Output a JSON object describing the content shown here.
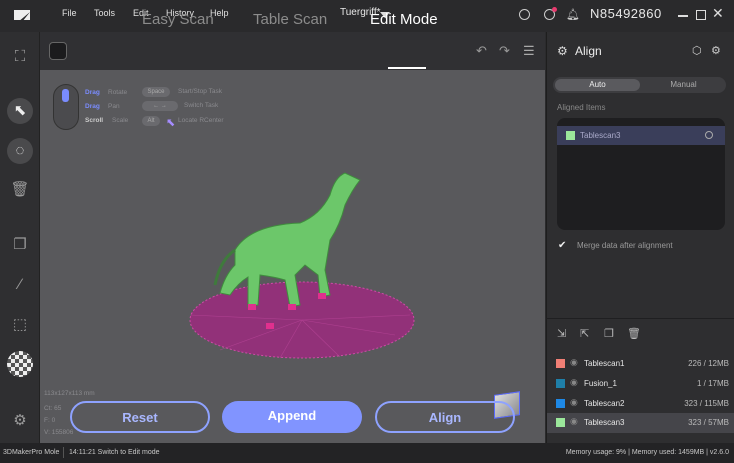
{
  "window": {
    "menu": [
      "File",
      "Tools",
      "Edit",
      "History",
      "Help"
    ],
    "document_title": "Tuergriff*",
    "user_id": "N85492860"
  },
  "scan_tabs": {
    "easy": "Easy Scan",
    "table": "Table Scan",
    "edit": "Edit Mode"
  },
  "hints": [
    {
      "key": "Drag",
      "action": "Rotate"
    },
    {
      "key": "Drag",
      "action": "Pan"
    },
    {
      "key": "Scroll",
      "action": "Scale"
    }
  ],
  "shortcuts": [
    {
      "key": "Space",
      "action": "Start/Stop Task"
    },
    {
      "key": "← →",
      "action": "Switch Task"
    },
    {
      "key": "Alt",
      "action": "Locate RCenter"
    }
  ],
  "viewport_stats": {
    "dimensions": "113x127x113 mm",
    "ct": "Ct: 65",
    "fps": "F: 0",
    "vertices": "V: 155806"
  },
  "actions": {
    "reset": "Reset",
    "append": "Append",
    "align": "Align"
  },
  "panel": {
    "title": "Align",
    "modes": {
      "auto": "Auto",
      "manual": "Manual"
    },
    "aligned_label": "Aligned Items",
    "aligned_item": "Tablescan3",
    "merge_label": "Merge data after alignment",
    "scans": [
      {
        "name": "Tablescan1",
        "info": "226 / 12MB",
        "color": "#f07f75"
      },
      {
        "name": "Fusion_1",
        "info": "1 / 17MB",
        "color": "#1f7fa8"
      },
      {
        "name": "Tablescan2",
        "info": "323 / 115MB",
        "color": "#1e88e5"
      },
      {
        "name": "Tablescan3",
        "info": "323 / 57MB",
        "color": "#9be79b"
      }
    ]
  },
  "status": {
    "app": "3DMakerPro Mole",
    "message": "14:11:21 Switch to Edit mode",
    "memory": "Memory usage: 9% | Memory used: 1459MB | v2.6.0"
  }
}
